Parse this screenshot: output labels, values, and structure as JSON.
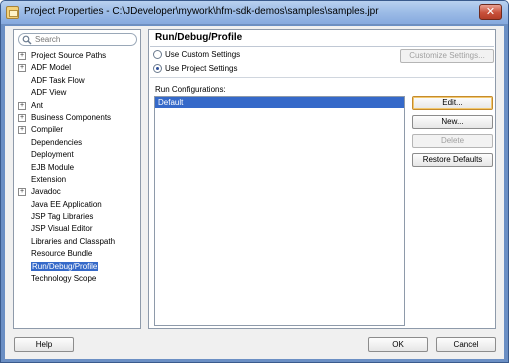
{
  "window": {
    "title": "Project Properties - C:\\JDeveloper\\mywork\\hfm-sdk-demos\\samples\\samples.jpr",
    "close_label": "✕"
  },
  "search": {
    "placeholder": "Search"
  },
  "nav": {
    "items": [
      {
        "label": "Project Source Paths",
        "expandable": true
      },
      {
        "label": "ADF Model",
        "expandable": true
      },
      {
        "label": "ADF Task Flow",
        "expandable": false
      },
      {
        "label": "ADF View",
        "expandable": false
      },
      {
        "label": "Ant",
        "expandable": true
      },
      {
        "label": "Business Components",
        "expandable": true
      },
      {
        "label": "Compiler",
        "expandable": true
      },
      {
        "label": "Dependencies",
        "expandable": false
      },
      {
        "label": "Deployment",
        "expandable": false
      },
      {
        "label": "EJB Module",
        "expandable": false
      },
      {
        "label": "Extension",
        "expandable": false
      },
      {
        "label": "Javadoc",
        "expandable": true
      },
      {
        "label": "Java EE Application",
        "expandable": false
      },
      {
        "label": "JSP Tag Libraries",
        "expandable": false
      },
      {
        "label": "JSP Visual Editor",
        "expandable": false
      },
      {
        "label": "Libraries and Classpath",
        "expandable": false
      },
      {
        "label": "Resource Bundle",
        "expandable": false
      },
      {
        "label": "Run/Debug/Profile",
        "expandable": false,
        "selected": true
      },
      {
        "label": "Technology Scope",
        "expandable": false
      }
    ]
  },
  "content": {
    "title": "Run/Debug/Profile",
    "radio_custom": "Use Custom Settings",
    "radio_project": "Use Project Settings",
    "customize_button": "Customize Settings...",
    "run_configs_label": "Run Configurations:",
    "configs": [
      "Default"
    ],
    "edit_button": "Edit...",
    "new_button": "New...",
    "delete_button": "Delete",
    "restore_button": "Restore Defaults"
  },
  "footer": {
    "help_button": "Help",
    "ok_button": "OK",
    "cancel_button": "Cancel"
  },
  "colors": {
    "selection": "#3569c9",
    "titlebar": "#9bbbe6",
    "close": "#c8503a"
  }
}
